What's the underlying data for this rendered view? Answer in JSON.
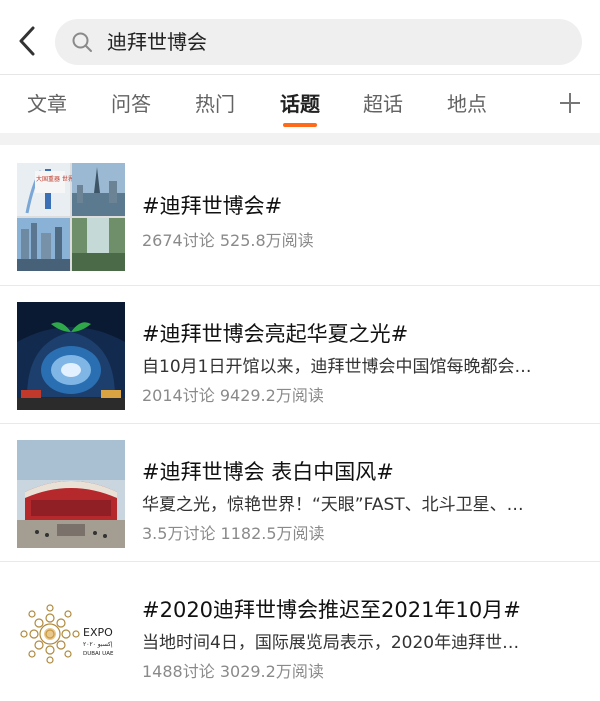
{
  "search": {
    "query": "迪拜世博会"
  },
  "tabs": [
    {
      "label": "文章"
    },
    {
      "label": "问答"
    },
    {
      "label": "热门"
    },
    {
      "label": "话题",
      "active": true
    },
    {
      "label": "超话"
    },
    {
      "label": "地点"
    }
  ],
  "accent_color": "#ff6a1a",
  "topics": [
    {
      "title": "#迪拜世博会#",
      "description": "",
      "discussions": "2674讨论",
      "reads": "525.8万阅读"
    },
    {
      "title": "#迪拜世博会亮起华夏之光#",
      "description": "自10月1日开馆以来，迪拜世博会中国馆每晚都会…",
      "discussions": "2014讨论",
      "reads": "9429.2万阅读"
    },
    {
      "title": "#迪拜世博会 表白中国风#",
      "description": "华夏之光，惊艳世界！“天眼”FAST、北斗卫星、…",
      "discussions": "3.5万讨论",
      "reads": "1182.5万阅读"
    },
    {
      "title": "#2020迪拜世博会推迟至2021年10月#",
      "description": "当地时间4日，国际展览局表示，2020年迪拜世…",
      "discussions": "1488讨论",
      "reads": "3029.2万阅读"
    }
  ],
  "thumb_texts": {
    "collage_banner": "大国重器 世界之窗",
    "expo_word": "EXPO",
    "expo_arabic": "إكسبو ٢٠٢٠",
    "expo_dubai": "DUBAI UAE"
  }
}
